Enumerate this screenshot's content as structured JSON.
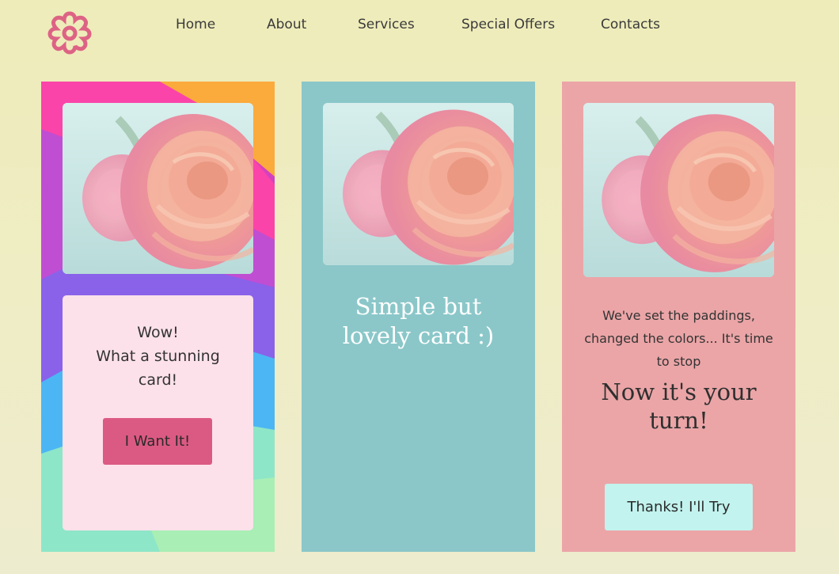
{
  "header": {
    "logo_icon": "flower-gear-icon",
    "nav": [
      {
        "label": "Home"
      },
      {
        "label": "About"
      },
      {
        "label": "Services"
      },
      {
        "label": "Special Offers"
      },
      {
        "label": "Contacts"
      }
    ]
  },
  "cards": [
    {
      "image": "pink-ranunculus-photo",
      "text_line1": "Wow!",
      "text_line2": "What a stunning card!",
      "button_label": "I Want It!"
    },
    {
      "image": "pink-ranunculus-photo",
      "title_line1": "Simple but",
      "title_line2": "lovely card :)"
    },
    {
      "image": "pink-ranunculus-photo",
      "text": "We've set the paddings, changed the colors... It's time to stop",
      "title": "Now it's your turn!",
      "button_label": "Thanks! I'll Try"
    }
  ],
  "colors": {
    "page_background": "#eeecb9",
    "logo": "#dd6385",
    "card2_background": "#8bc7c9",
    "card3_background": "#eba5a7",
    "inner_box": "#fde1ea",
    "primary_button": "#db5a83",
    "secondary_button": "#c2f3ee"
  }
}
